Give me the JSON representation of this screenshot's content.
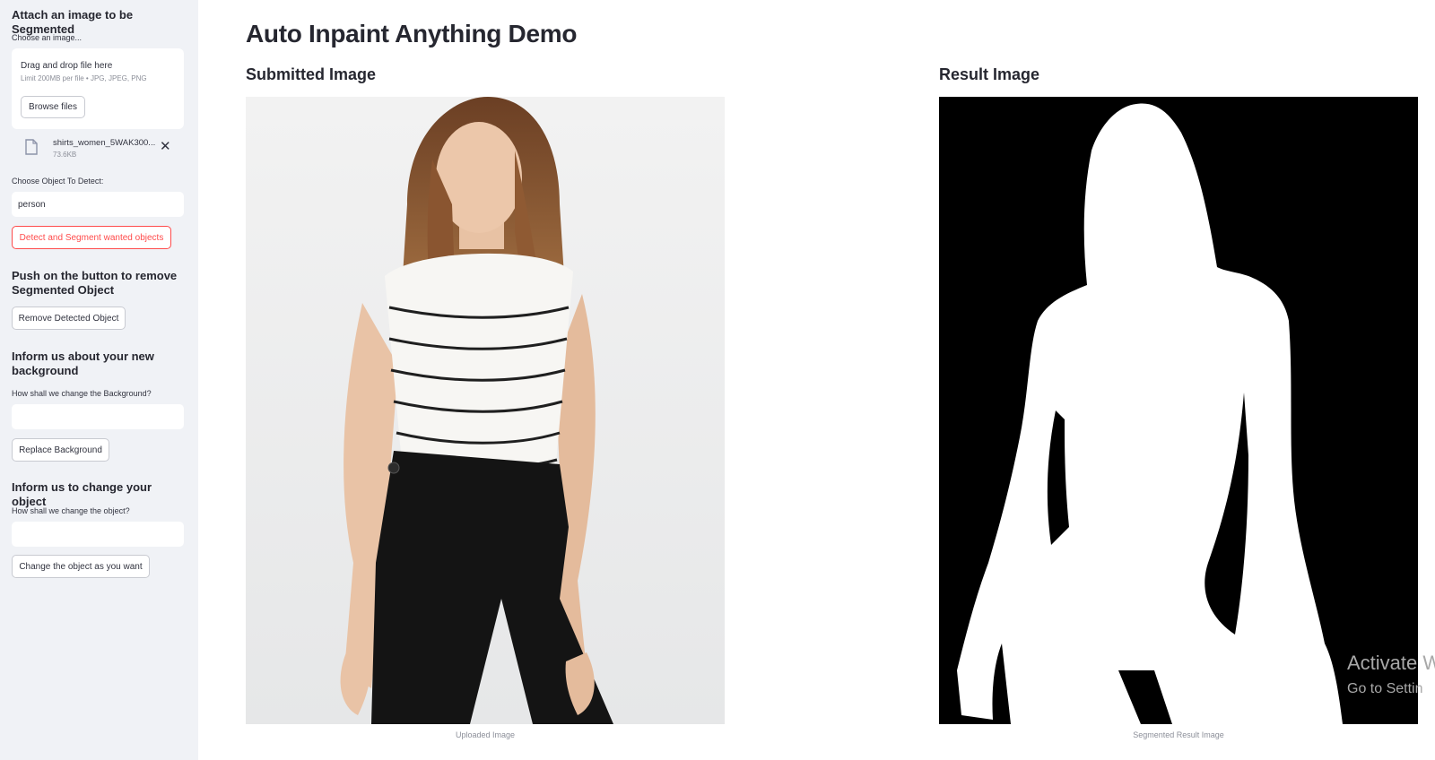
{
  "sidebar": {
    "upload_heading": "Attach an image to be Segmented",
    "upload_label": "Choose an image...",
    "dropzone_title": "Drag and drop file here",
    "dropzone_limit": "Limit 200MB per file • JPG, JPEG, PNG",
    "browse_label": "Browse files",
    "file_name": "shirts_women_5WAK300...",
    "file_size": "73.6KB",
    "object_label": "Choose Object To Detect:",
    "object_value": "person",
    "detect_button": "Detect and Segment wanted objects",
    "remove_heading": "Push on the button to remove Segmented Object",
    "remove_button": "Remove Detected Object",
    "background_heading": "Inform us about your new background",
    "background_label": "How shall we change the Background?",
    "background_value": "",
    "background_button": "Replace Background",
    "object_change_heading": "Inform us to change your object",
    "object_change_label": "How shall we change the object?",
    "object_change_value": "",
    "object_change_button": "Change the object as you want"
  },
  "main": {
    "title": "Auto Inpaint Anything Demo",
    "submitted_heading": "Submitted Image",
    "result_heading": "Result Image",
    "submitted_caption": "Uploaded Image",
    "result_caption": "Segmented Result Image"
  },
  "overlay": {
    "watermark_line1": "Activate W",
    "watermark_line2": "Go to Settin"
  },
  "colors": {
    "sidebar_bg": "#f0f2f6",
    "accent": "#ff4b4b",
    "text": "#262730"
  },
  "icons": {
    "file": "file-icon",
    "close": "close-icon"
  }
}
